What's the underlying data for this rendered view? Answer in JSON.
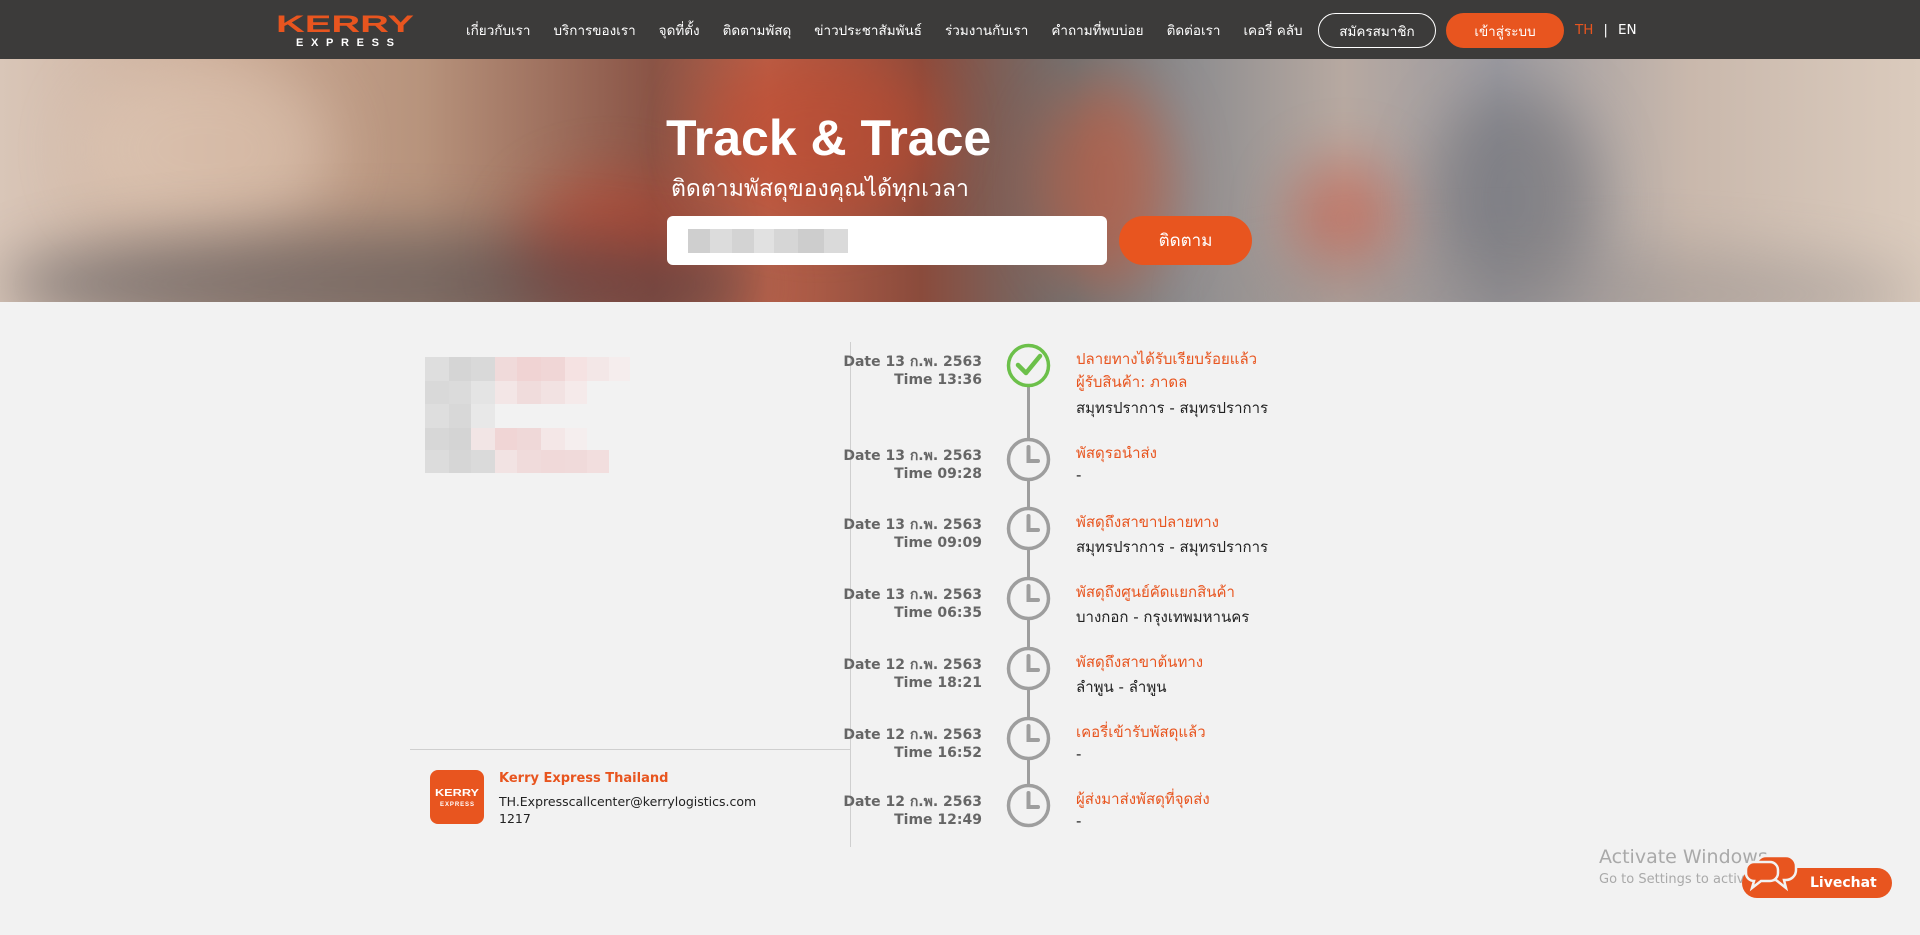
{
  "brand": {
    "logo_top": "KERRY",
    "logo_bottom": "EXPRESS"
  },
  "nav": {
    "items": [
      "เกี่ยวกับเรา",
      "บริการของเรา",
      "จุดที่ตั้ง",
      "ติดตามพัสดุ",
      "ข่าวประชาสัมพันธ์",
      "ร่วมงานกับเรา",
      "คำถามที่พบบ่อย",
      "ติดต่อเรา",
      "เคอรี่ คลับ"
    ],
    "register_label": "สมัครสมาชิก",
    "login_label": "เข้าสู่ระบบ",
    "lang_th": "TH",
    "lang_sep": "|",
    "lang_en": "EN"
  },
  "hero": {
    "title": "Track & Trace",
    "subtitle": "ติดตามพัสดุของคุณได้ทุกเวลา",
    "track_button": "ติดตาม"
  },
  "company": {
    "name": "Kerry Express Thailand",
    "email": "TH.Expresscallcenter@kerrylogistics.com",
    "phone": "1217"
  },
  "timeline": [
    {
      "date": "Date 13 ก.พ. 2563",
      "time": "Time 13:36",
      "status": "ปลายทางได้รับเรียบร้อยแล้ว",
      "recipient": "ผู้รับสินค้า: ภาดล",
      "location": "สมุทรปราการ - สมุทรปราการ",
      "icon": "check-circle-icon"
    },
    {
      "date": "Date 13 ก.พ. 2563",
      "time": "Time 09:28",
      "status": "พัสดุรอนำส่ง",
      "location": "-",
      "icon": "clock-icon"
    },
    {
      "date": "Date 13 ก.พ. 2563",
      "time": "Time 09:09",
      "status": "พัสดุถึงสาขาปลายทาง",
      "location": "สมุทรปราการ - สมุทรปราการ",
      "icon": "clock-icon"
    },
    {
      "date": "Date 13 ก.พ. 2563",
      "time": "Time 06:35",
      "status": "พัสดุถึงศูนย์คัดแยกสินค้า",
      "location": "บางกอก - กรุงเทพมหานคร",
      "icon": "clock-icon"
    },
    {
      "date": "Date 12 ก.พ. 2563",
      "time": "Time 18:21",
      "status": "พัสดุถึงสาขาต้นทาง",
      "location": "ลำพูน - ลำพูน",
      "icon": "clock-icon"
    },
    {
      "date": "Date 12 ก.พ. 2563",
      "time": "Time 16:52",
      "status": "เคอรี่เข้ารับพัสดุแล้ว",
      "location": "-",
      "icon": "clock-icon"
    },
    {
      "date": "Date 12 ก.พ. 2563",
      "time": "Time 12:49",
      "status": "ผู้ส่งมาส่งพัสดุที่จุดส่ง",
      "location": "-",
      "icon": "clock-icon"
    }
  ],
  "watermark": {
    "title": "Activate Windows",
    "subtitle": "Go to Settings to activate Windows."
  },
  "livechat": {
    "label": "Livechat"
  },
  "colors": {
    "accent": "#e8551f",
    "nav_bg": "#3c3b3a",
    "page_bg": "#f2f2f2",
    "success": "#6cc04a",
    "timeline": "#9e9e9e"
  }
}
